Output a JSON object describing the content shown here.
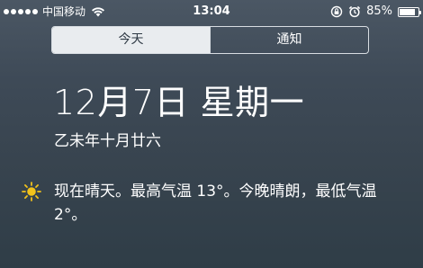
{
  "status_bar": {
    "carrier": "中国移动",
    "time": "13:04",
    "battery_percent_text": "85%",
    "battery_level": 0.85,
    "icons": [
      "signal-dots-icon",
      "wifi-icon",
      "rotation-lock-icon",
      "alarm-icon",
      "battery-icon"
    ]
  },
  "tabs": [
    {
      "label": "今天",
      "active": true
    },
    {
      "label": "通知",
      "active": false
    }
  ],
  "today": {
    "date": "12月7日 星期一",
    "lunar": "乙未年十月廿六"
  },
  "weather": {
    "icon": "sun-icon",
    "icon_color": "#f2c21b",
    "summary": "现在晴天。最高气温 13°。今晚晴朗，最低气温 2°。"
  }
}
